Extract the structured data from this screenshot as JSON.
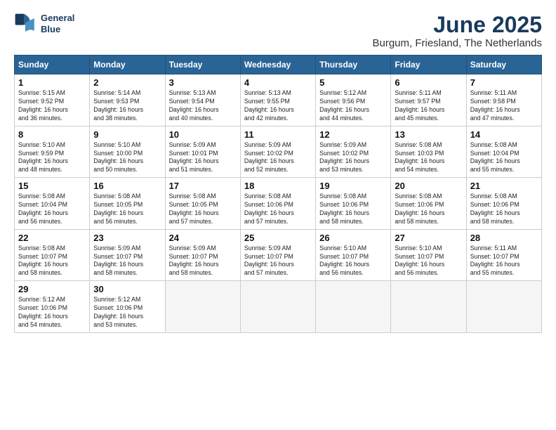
{
  "logo": {
    "line1": "General",
    "line2": "Blue"
  },
  "title": "June 2025",
  "location": "Burgum, Friesland, The Netherlands",
  "days_of_week": [
    "Sunday",
    "Monday",
    "Tuesday",
    "Wednesday",
    "Thursday",
    "Friday",
    "Saturday"
  ],
  "weeks": [
    [
      {
        "day": "1",
        "info": "Sunrise: 5:15 AM\nSunset: 9:52 PM\nDaylight: 16 hours\nand 36 minutes."
      },
      {
        "day": "2",
        "info": "Sunrise: 5:14 AM\nSunset: 9:53 PM\nDaylight: 16 hours\nand 38 minutes."
      },
      {
        "day": "3",
        "info": "Sunrise: 5:13 AM\nSunset: 9:54 PM\nDaylight: 16 hours\nand 40 minutes."
      },
      {
        "day": "4",
        "info": "Sunrise: 5:13 AM\nSunset: 9:55 PM\nDaylight: 16 hours\nand 42 minutes."
      },
      {
        "day": "5",
        "info": "Sunrise: 5:12 AM\nSunset: 9:56 PM\nDaylight: 16 hours\nand 44 minutes."
      },
      {
        "day": "6",
        "info": "Sunrise: 5:11 AM\nSunset: 9:57 PM\nDaylight: 16 hours\nand 45 minutes."
      },
      {
        "day": "7",
        "info": "Sunrise: 5:11 AM\nSunset: 9:58 PM\nDaylight: 16 hours\nand 47 minutes."
      }
    ],
    [
      {
        "day": "8",
        "info": "Sunrise: 5:10 AM\nSunset: 9:59 PM\nDaylight: 16 hours\nand 48 minutes."
      },
      {
        "day": "9",
        "info": "Sunrise: 5:10 AM\nSunset: 10:00 PM\nDaylight: 16 hours\nand 50 minutes."
      },
      {
        "day": "10",
        "info": "Sunrise: 5:09 AM\nSunset: 10:01 PM\nDaylight: 16 hours\nand 51 minutes."
      },
      {
        "day": "11",
        "info": "Sunrise: 5:09 AM\nSunset: 10:02 PM\nDaylight: 16 hours\nand 52 minutes."
      },
      {
        "day": "12",
        "info": "Sunrise: 5:09 AM\nSunset: 10:02 PM\nDaylight: 16 hours\nand 53 minutes."
      },
      {
        "day": "13",
        "info": "Sunrise: 5:08 AM\nSunset: 10:03 PM\nDaylight: 16 hours\nand 54 minutes."
      },
      {
        "day": "14",
        "info": "Sunrise: 5:08 AM\nSunset: 10:04 PM\nDaylight: 16 hours\nand 55 minutes."
      }
    ],
    [
      {
        "day": "15",
        "info": "Sunrise: 5:08 AM\nSunset: 10:04 PM\nDaylight: 16 hours\nand 56 minutes."
      },
      {
        "day": "16",
        "info": "Sunrise: 5:08 AM\nSunset: 10:05 PM\nDaylight: 16 hours\nand 56 minutes."
      },
      {
        "day": "17",
        "info": "Sunrise: 5:08 AM\nSunset: 10:05 PM\nDaylight: 16 hours\nand 57 minutes."
      },
      {
        "day": "18",
        "info": "Sunrise: 5:08 AM\nSunset: 10:06 PM\nDaylight: 16 hours\nand 57 minutes."
      },
      {
        "day": "19",
        "info": "Sunrise: 5:08 AM\nSunset: 10:06 PM\nDaylight: 16 hours\nand 58 minutes."
      },
      {
        "day": "20",
        "info": "Sunrise: 5:08 AM\nSunset: 10:06 PM\nDaylight: 16 hours\nand 58 minutes."
      },
      {
        "day": "21",
        "info": "Sunrise: 5:08 AM\nSunset: 10:06 PM\nDaylight: 16 hours\nand 58 minutes."
      }
    ],
    [
      {
        "day": "22",
        "info": "Sunrise: 5:08 AM\nSunset: 10:07 PM\nDaylight: 16 hours\nand 58 minutes."
      },
      {
        "day": "23",
        "info": "Sunrise: 5:09 AM\nSunset: 10:07 PM\nDaylight: 16 hours\nand 58 minutes."
      },
      {
        "day": "24",
        "info": "Sunrise: 5:09 AM\nSunset: 10:07 PM\nDaylight: 16 hours\nand 58 minutes."
      },
      {
        "day": "25",
        "info": "Sunrise: 5:09 AM\nSunset: 10:07 PM\nDaylight: 16 hours\nand 57 minutes."
      },
      {
        "day": "26",
        "info": "Sunrise: 5:10 AM\nSunset: 10:07 PM\nDaylight: 16 hours\nand 56 minutes."
      },
      {
        "day": "27",
        "info": "Sunrise: 5:10 AM\nSunset: 10:07 PM\nDaylight: 16 hours\nand 56 minutes."
      },
      {
        "day": "28",
        "info": "Sunrise: 5:11 AM\nSunset: 10:07 PM\nDaylight: 16 hours\nand 55 minutes."
      }
    ],
    [
      {
        "day": "29",
        "info": "Sunrise: 5:12 AM\nSunset: 10:06 PM\nDaylight: 16 hours\nand 54 minutes."
      },
      {
        "day": "30",
        "info": "Sunrise: 5:12 AM\nSunset: 10:06 PM\nDaylight: 16 hours\nand 53 minutes."
      },
      {
        "day": "",
        "info": ""
      },
      {
        "day": "",
        "info": ""
      },
      {
        "day": "",
        "info": ""
      },
      {
        "day": "",
        "info": ""
      },
      {
        "day": "",
        "info": ""
      }
    ]
  ]
}
